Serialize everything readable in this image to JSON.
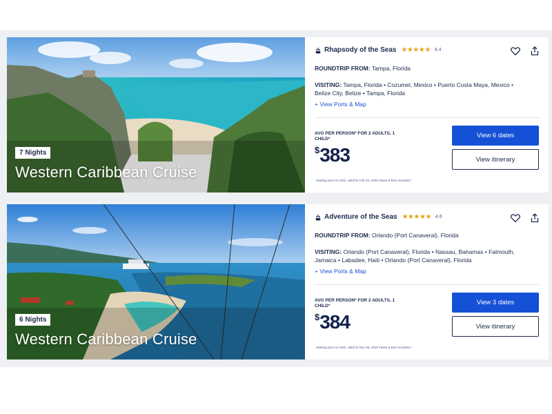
{
  "colors": {
    "primary_button": "#1551d6",
    "link": "#1f4fd8",
    "text_navy": "#1d2a4d",
    "star_gold": "#e8a317"
  },
  "cruises": [
    {
      "nights_badge": "7 Nights",
      "title": "Western Caribbean Cruise",
      "ship_name": "Rhapsody of the Seas",
      "stars": "★★★★★",
      "rating": "4.4",
      "roundtrip_label": "ROUNDTRIP FROM:",
      "roundtrip_value": "Tampa, Florida",
      "visiting_label": "VISITING:",
      "visiting_value": "Tampa, Florida • Cozumel, Mexico • Puerto Costa Maya, Mexico • Belize City, Belize • Tampa, Florida",
      "ports_link": "+ View Ports & Map",
      "avg_label": "AVG PER PERSON* FOR 2 ADULTS, 1 CHILD*",
      "currency": "$",
      "price": "383",
      "fine_print": "Starting price in USD, valid for Feb 28, 2026 Taxes & fees included.*",
      "dates_button": "View 6 dates",
      "itinerary_button": "View itinerary",
      "icons": {
        "ship": "ship-icon",
        "heart": "heart-icon",
        "share": "share-icon"
      }
    },
    {
      "nights_badge": "6 Nights",
      "title": "Western Caribbean Cruise",
      "ship_name": "Adventure of the Seas",
      "stars": "★★★★★",
      "rating": "4.6",
      "roundtrip_label": "ROUNDTRIP FROM:",
      "roundtrip_value": "Orlando (Port Canaveral), Florida",
      "visiting_label": "VISITING:",
      "visiting_value": "Orlando (Port Canaveral), Florida • Nassau, Bahamas • Falmouth, Jamaica • Labadee, Haiti • Orlando (Port Canaveral), Florida",
      "ports_link": "+ View Ports & Map",
      "avg_label": "AVG PER PERSON* FOR 2 ADULTS, 1 CHILD*",
      "currency": "$",
      "price": "384",
      "fine_print": "Starting price in USD, valid for Dec 06, 2025 Taxes & fees included.*",
      "dates_button": "View 3 dates",
      "itinerary_button": "View itinerary",
      "icons": {
        "ship": "ship-icon",
        "heart": "heart-icon",
        "share": "share-icon"
      }
    }
  ]
}
